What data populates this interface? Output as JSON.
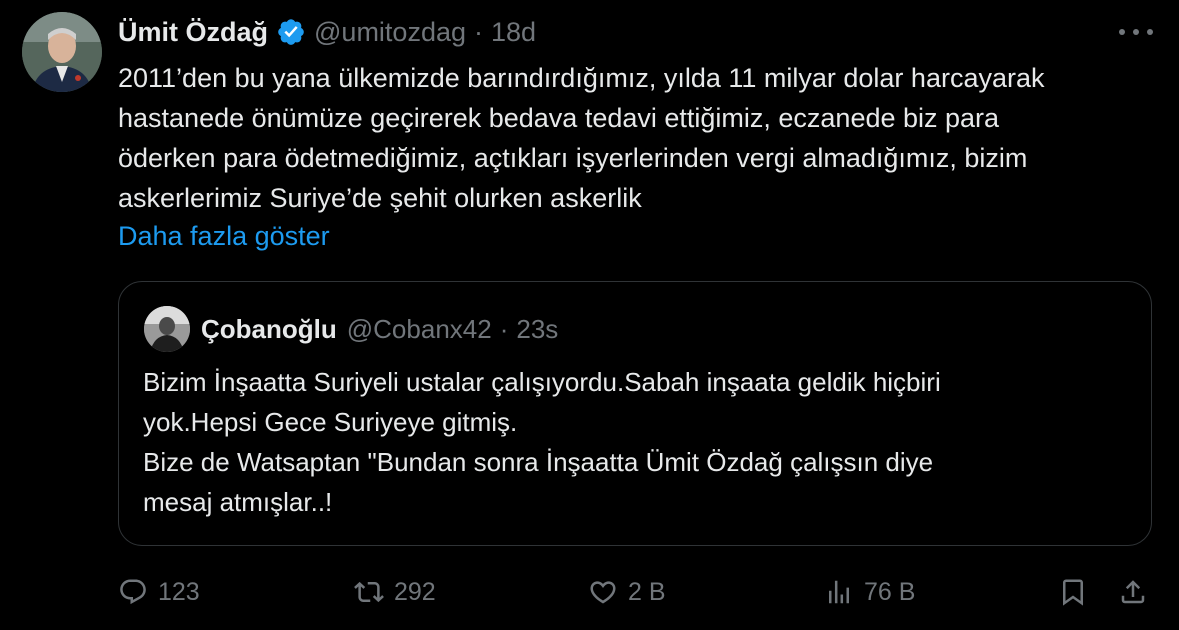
{
  "tweet": {
    "author_name": "Ümit Özdağ",
    "author_handle": "@umitozdag",
    "separator": "·",
    "time": "18d",
    "text": "2011’den bu yana ülkemizde barındırdığımız, yılda 11 milyar dolar harcayarak\nhastanede önümüze geçirerek bedava tedavi ettiğimiz, eczanede biz para\nöderken para ödetmediğimiz, açtıkları işyerlerinden vergi almadığımız, bizim\naskerlerimiz Suriye’de şehit olurken askerlik",
    "show_more": "Daha fazla göster"
  },
  "quote": {
    "author_name": "Çobanoğlu",
    "author_handle": "@Cobanx42",
    "separator": "·",
    "time": "23s",
    "text": "Bizim İnşaatta Suriyeli ustalar çalışıyordu.Sabah inşaata geldik hiçbiri\nyok.Hepsi Gece Suriyeye gitmiş.\nBize de Watsaptan \"Bundan sonra İnşaatta Ümit Özdağ çalışsın diye\nmesaj atmışlar..!"
  },
  "actions": {
    "replies": "123",
    "retweets": "292",
    "likes": "2 B",
    "views": "76 B"
  },
  "icons": [
    "verified-badge-icon",
    "more-icon",
    "reply-icon",
    "retweet-icon",
    "like-icon",
    "views-icon",
    "bookmark-icon",
    "share-icon"
  ],
  "colors": {
    "background": "#000000",
    "text": "#e7e9ea",
    "secondary": "#71767b",
    "link": "#1d9bf0",
    "border": "#2f3336"
  }
}
